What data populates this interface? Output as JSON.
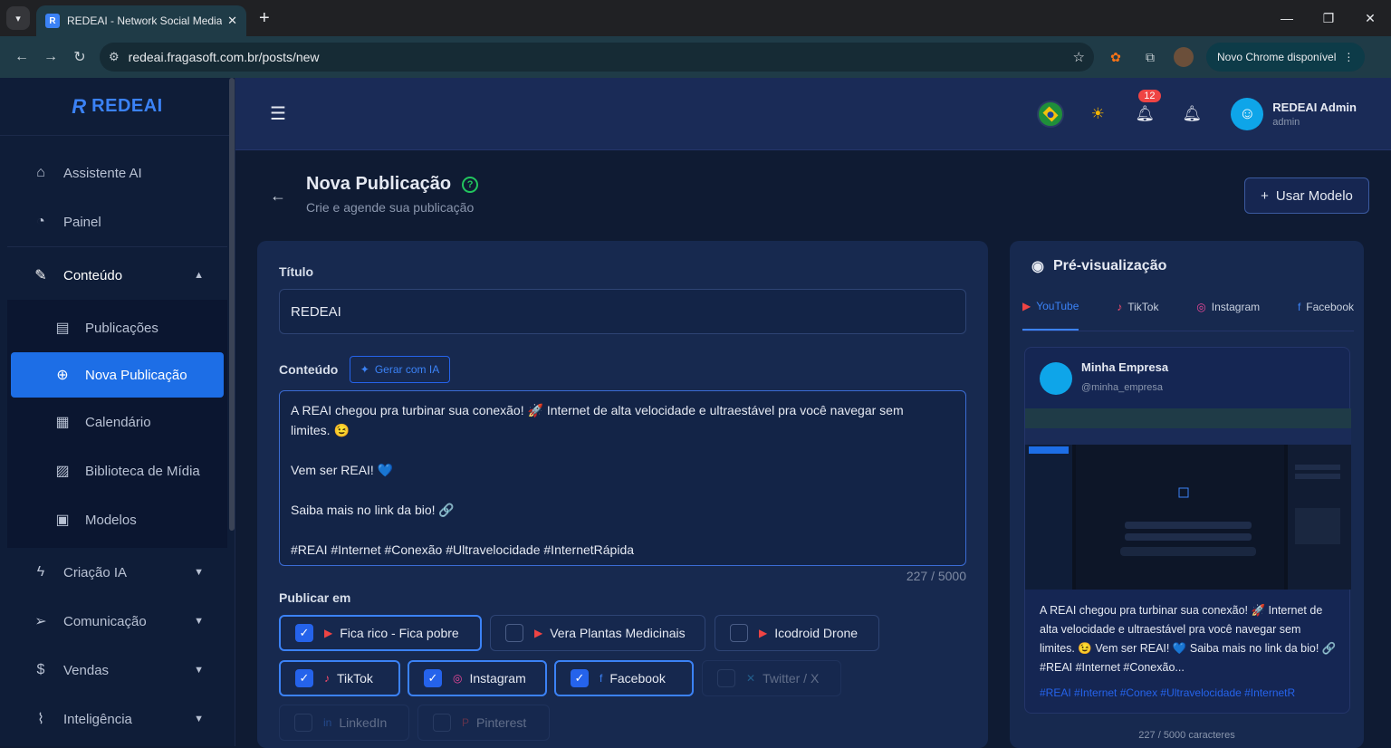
{
  "browser": {
    "tab_title": "REDEAI - Network Social Media",
    "tab_fav": "R",
    "url": "redeai.fragasoft.com.br/posts/new",
    "update_label": "Novo Chrome disponível"
  },
  "sidebar": {
    "logo_mark": "R",
    "logo_text": "REDEAI",
    "items": [
      {
        "label": "Assistente AI",
        "icon": "home-icon"
      },
      {
        "label": "Painel",
        "icon": "gauge-icon"
      },
      {
        "label": "Conteúdo",
        "icon": "pen-icon"
      }
    ],
    "sub_items": [
      {
        "label": "Publicações",
        "icon": "document-icon"
      },
      {
        "label": "Nova Publicação",
        "icon": "plus-circle-icon"
      },
      {
        "label": "Calendário",
        "icon": "calendar-icon"
      },
      {
        "label": "Biblioteca de Mídia",
        "icon": "image-icon"
      },
      {
        "label": "Modelos",
        "icon": "grid-icon"
      }
    ],
    "groups": [
      {
        "label": "Criação IA",
        "icon": "bolt-icon"
      },
      {
        "label": "Comunicação",
        "icon": "send-icon"
      },
      {
        "label": "Vendas",
        "icon": "dollar-icon"
      },
      {
        "label": "Inteligência",
        "icon": "chart-icon"
      }
    ]
  },
  "header": {
    "badge": "12",
    "user_name": "REDEAI Admin",
    "user_role": "admin"
  },
  "page": {
    "title": "Nova Publicação",
    "subtitle": "Crie e agende sua publicação",
    "use_template": "Usar Modelo"
  },
  "form": {
    "title_label": "Título",
    "title_value": "REDEAI",
    "content_label": "Conteúdo",
    "gen_ai": "Gerar com IA",
    "content_lines": {
      "l1": "A REAI chegou pra turbinar sua conexão! 🚀 Internet de alta velocidade e ultraestável pra você navegar sem",
      "l2": "limites. 😉",
      "l3": "Vem ser REAI! 💙",
      "l4": "Saiba mais no link da bio! 🔗",
      "l5": "#REAI #Internet #Conexão #Ultravelocidade #InternetRápida"
    },
    "char_count": "227 / 5000",
    "publish_label": "Publicar em",
    "channels": [
      {
        "label": "Fica rico - Fica pobre",
        "platform": "youtube"
      },
      {
        "label": "Vera Plantas Medicinais",
        "platform": "youtube"
      },
      {
        "label": "Icodroid Drone",
        "platform": "youtube"
      },
      {
        "label": "TikTok",
        "platform": "tiktok"
      },
      {
        "label": "Instagram",
        "platform": "instagram"
      },
      {
        "label": "Facebook",
        "platform": "facebook"
      },
      {
        "label": "Twitter / X",
        "platform": "twitter"
      },
      {
        "label": "LinkedIn",
        "platform": "linkedin"
      },
      {
        "label": "Pinterest",
        "platform": "pinterest"
      }
    ]
  },
  "preview": {
    "title": "Pré-visualização",
    "tabs": [
      "YouTube",
      "TikTok",
      "Instagram",
      "Facebook"
    ],
    "account_name": "Minha Empresa",
    "account_handle": "@minha_empresa",
    "text": "A REAI chegou pra turbinar sua conexão! 🚀 Internet de alta velocidade e ultraestável pra você navegar sem limites. 😉 Vem ser REAI! 💙 Saiba mais no link da bio! 🔗 #REAI #Internet #Conexão...",
    "tags": "#REAI #Internet #Conex #Ultravelocidade #InternetR",
    "count": "227 / 5000 caracteres"
  }
}
